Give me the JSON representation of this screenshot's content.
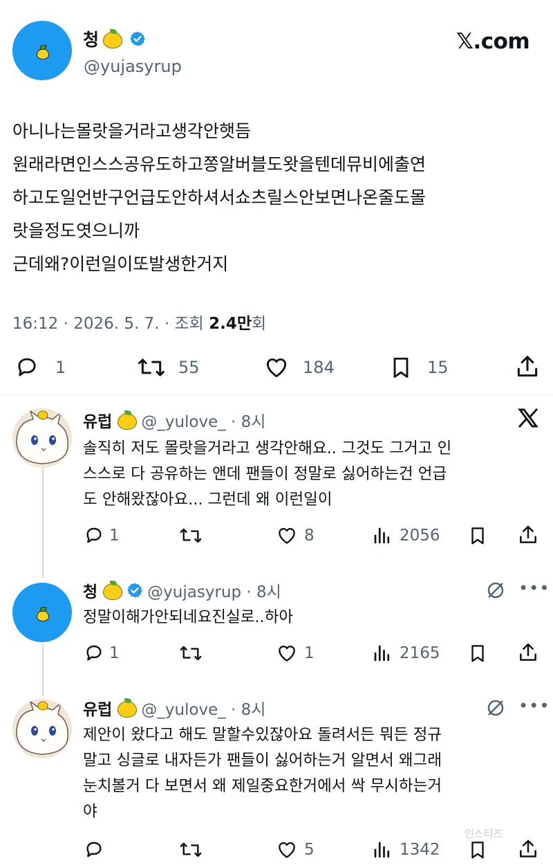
{
  "main_tweet": {
    "author_name": "청",
    "handle": "@yujasyrup",
    "site_label": "𝕏.com",
    "text_lines": [
      "아니나는몰랏을거라고생각안햇듬",
      "원래라면인스스공유도하고쫑알버블도왓을텐데뮤비에출연",
      "하고도일언반구언급도안하셔서쇼츠릴스안보면나온줄도몰",
      "랏을정도엿으니까",
      "근데왜?이런일이또발생한거지"
    ],
    "meta_prefix": "16:12 · 2026. 5. 7. · 조회 ",
    "views_bold": "2.4만",
    "views_suffix": "회",
    "stats": {
      "replies": "1",
      "retweets": "55",
      "likes": "184",
      "bookmarks": "15"
    }
  },
  "replies": [
    {
      "author_name": "유럽",
      "handle_time": "@_yulove_ · 8시",
      "text_lines": [
        "솔직히 저도 몰랏을거라고 생각안해요.. 그것도 그거고 인",
        "스스로 다 공유하는 앤데 팬들이 정말로 싫어하는건 언급",
        "도 안해왔잖아요... 그런데 왜 이런일이"
      ],
      "stats": {
        "replies": "1",
        "retweets": "",
        "likes": "8",
        "views": "2056"
      }
    },
    {
      "author_name": "청",
      "handle_time": "@yujasyrup · 8시",
      "text_lines": [
        "정말이해가안되네요진실로..하아"
      ],
      "stats": {
        "replies": "1",
        "retweets": "",
        "likes": "1",
        "views": "2165"
      }
    },
    {
      "author_name": "유럽",
      "handle_time": "@_yulove_ · 8시",
      "text_lines": [
        "제안이 왔다고 해도 말할수있잖아요 돌려서든 뭐든 정규",
        "말고 싱글로 내자든가 팬들이 싫어하는거 알면서 왜그래",
        "눈치볼거 다 보면서 왜 제일중요한거에서 싹 무시하는거",
        "야"
      ],
      "stats": {
        "replies": "",
        "retweets": "",
        "likes": "5",
        "views": "1342"
      }
    }
  ],
  "watermark": "인스티즈",
  "colors": {
    "accent": "#1d9bf0",
    "muted": "#536471",
    "text": "#0f1419",
    "lemon": "#f9cc16"
  }
}
